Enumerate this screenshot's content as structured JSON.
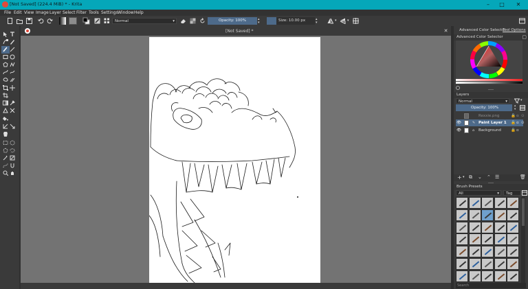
{
  "window": {
    "title": "[Not Saved]  (224.4 MiB)  * - Krita"
  },
  "menu": [
    "File",
    "Edit",
    "View",
    "Image",
    "Layer",
    "Select",
    "Filter",
    "Tools",
    "Settings",
    "Window",
    "Help"
  ],
  "toolbar": {
    "blend_mode": "Normal",
    "opacity_label": "Opacity: 100%",
    "size_label": "Size: 10.00 px"
  },
  "document": {
    "tab_title": "[Not Saved]  *"
  },
  "dock": {
    "tabs": [
      "Advanced Color Selector",
      "Tool Options"
    ],
    "color_selector_header": "Advanced Color Selector",
    "layers_header": "Layers",
    "layers_blend": "Normal",
    "layers_opacity": "Opacity:  100%",
    "layers": [
      {
        "name": "Rexxie.png"
      },
      {
        "name": "Paint Layer 1"
      },
      {
        "name": "Background"
      }
    ],
    "brush_presets_header": "Brush Presets",
    "brush_filter": "All",
    "brush_tag": "Tag",
    "search_label": "Search"
  },
  "colors": {
    "accent": "#05a7b9",
    "selection": "#4d6a8a"
  }
}
